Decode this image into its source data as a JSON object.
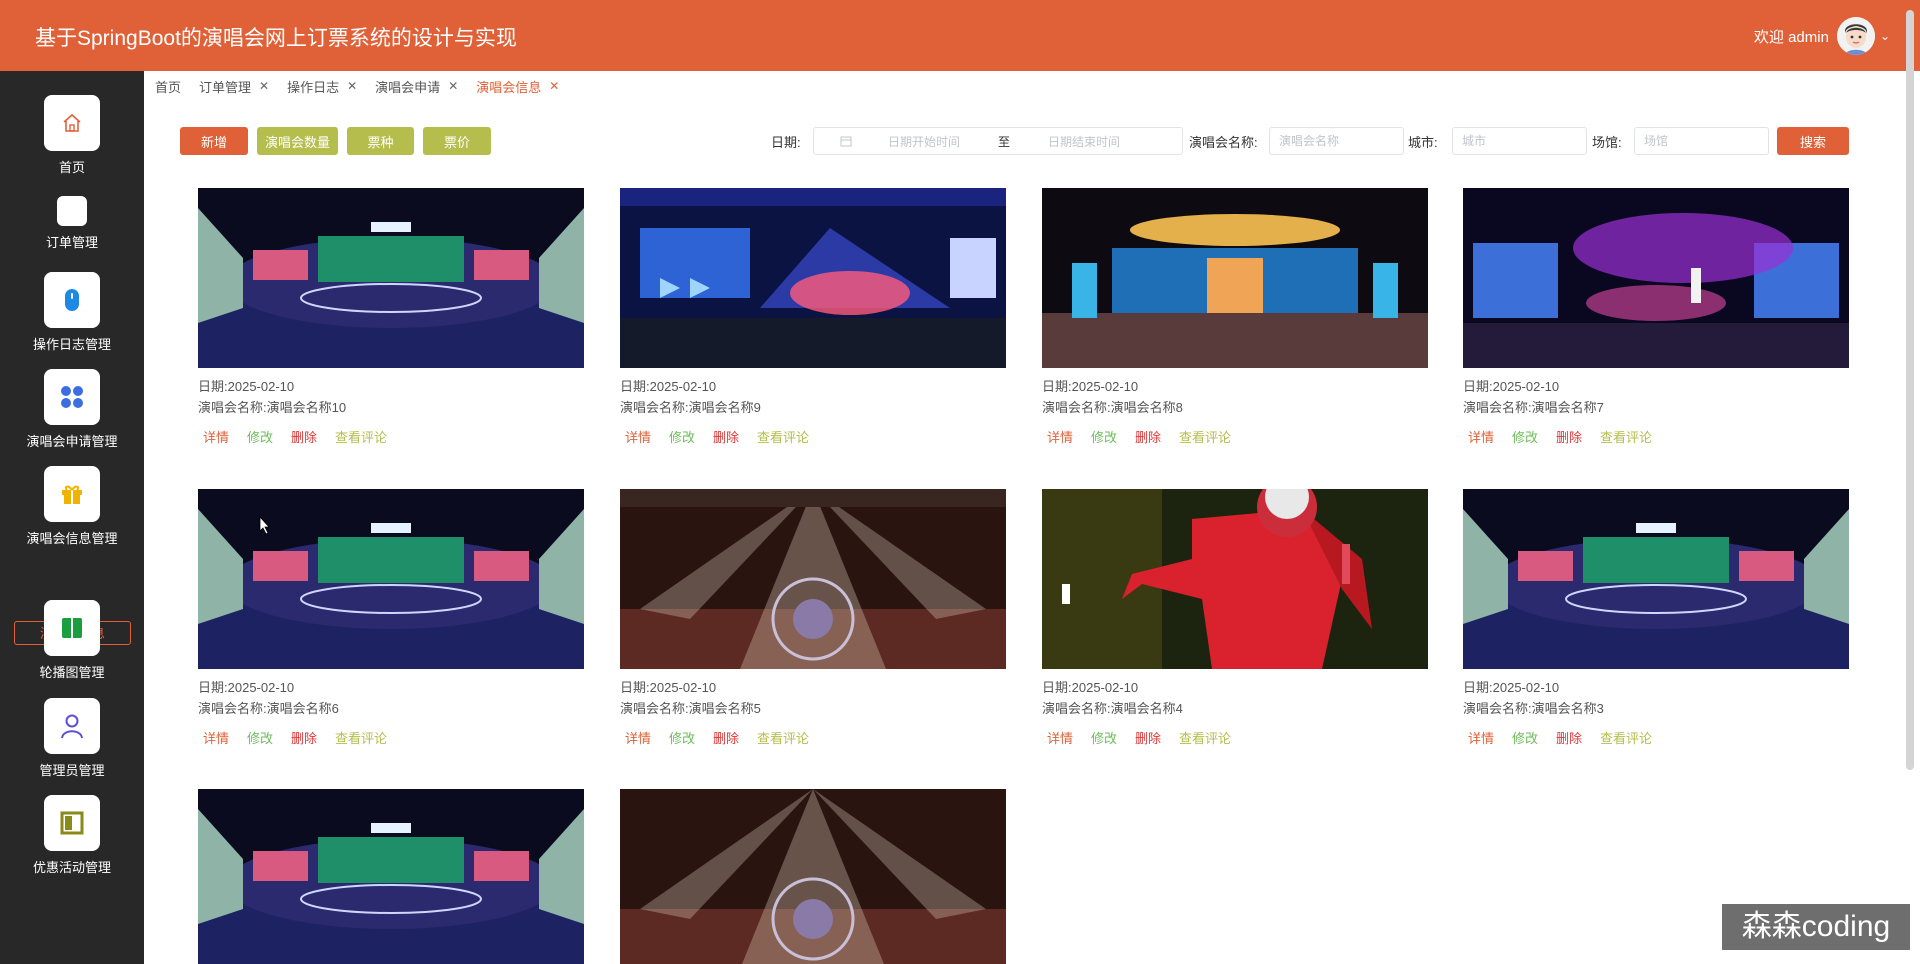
{
  "header": {
    "title": "基于SpringBoot的演唱会网上订票系统的设计与实现",
    "welcome": "欢迎 admin"
  },
  "sidebar": {
    "items": [
      {
        "label": "首页",
        "icon": "home-icon"
      },
      {
        "label": "订单管理",
        "icon": "order-icon"
      },
      {
        "label": "操作日志管理",
        "icon": "log-icon"
      },
      {
        "label": "演唱会申请管理",
        "icon": "apps-icon"
      },
      {
        "label": "演唱会信息管理",
        "icon": "gift-icon"
      },
      {
        "label": "轮播图管理",
        "icon": "carousel-icon"
      },
      {
        "label": "管理员管理",
        "icon": "admin-user-icon"
      },
      {
        "label": "优惠活动管理",
        "icon": "promotion-icon"
      }
    ],
    "sub_item": "演唱会信息"
  },
  "tabs": [
    {
      "label": "首页"
    },
    {
      "label": "订单管理"
    },
    {
      "label": "操作日志"
    },
    {
      "label": "演唱会申请"
    },
    {
      "label": "演唱会信息",
      "active": true
    }
  ],
  "toolbar": {
    "add": "新增",
    "count": "演唱会数量",
    "ticket_type": "票种",
    "price": "票价"
  },
  "filters": {
    "date_label": "日期:",
    "date_start_placeholder": "日期开始时间",
    "date_sep": "至",
    "date_end_placeholder": "日期结束时间",
    "name_label": "演唱会名称:",
    "name_placeholder": "演唱会名称",
    "city_label": "城市:",
    "city_placeholder": "城市",
    "venue_label": "场馆:",
    "venue_placeholder": "场馆",
    "search": "搜索"
  },
  "card_labels": {
    "date_prefix": "日期:",
    "name_prefix": "演唱会名称:",
    "detail": "详情",
    "edit": "修改",
    "delete": "删除",
    "review": "查看评论"
  },
  "cards": [
    {
      "date": "2025-02-10",
      "name": "演唱会名称10",
      "image": "stage-oppo"
    },
    {
      "date": "2025-02-10",
      "name": "演唱会名称9",
      "image": "stage-blue"
    },
    {
      "date": "2025-02-10",
      "name": "演唱会名称8",
      "image": "stage-arena"
    },
    {
      "date": "2025-02-10",
      "name": "演唱会名称7",
      "image": "stage-purple"
    },
    {
      "date": "2025-02-10",
      "name": "演唱会名称6",
      "image": "stage-oppo"
    },
    {
      "date": "2025-02-10",
      "name": "演唱会名称5",
      "image": "stage-round"
    },
    {
      "date": "2025-02-10",
      "name": "演唱会名称4",
      "image": "singer-red"
    },
    {
      "date": "2025-02-10",
      "name": "演唱会名称3",
      "image": "stage-oppo"
    },
    {
      "image": "stage-oppo"
    },
    {
      "image": "stage-round"
    }
  ],
  "watermark": "森森coding",
  "colors": {
    "primary": "#e06138",
    "sidebar": "#282828",
    "olive": "#b5bd4d",
    "edit": "#6dbd5b",
    "delete": "#e03838"
  }
}
